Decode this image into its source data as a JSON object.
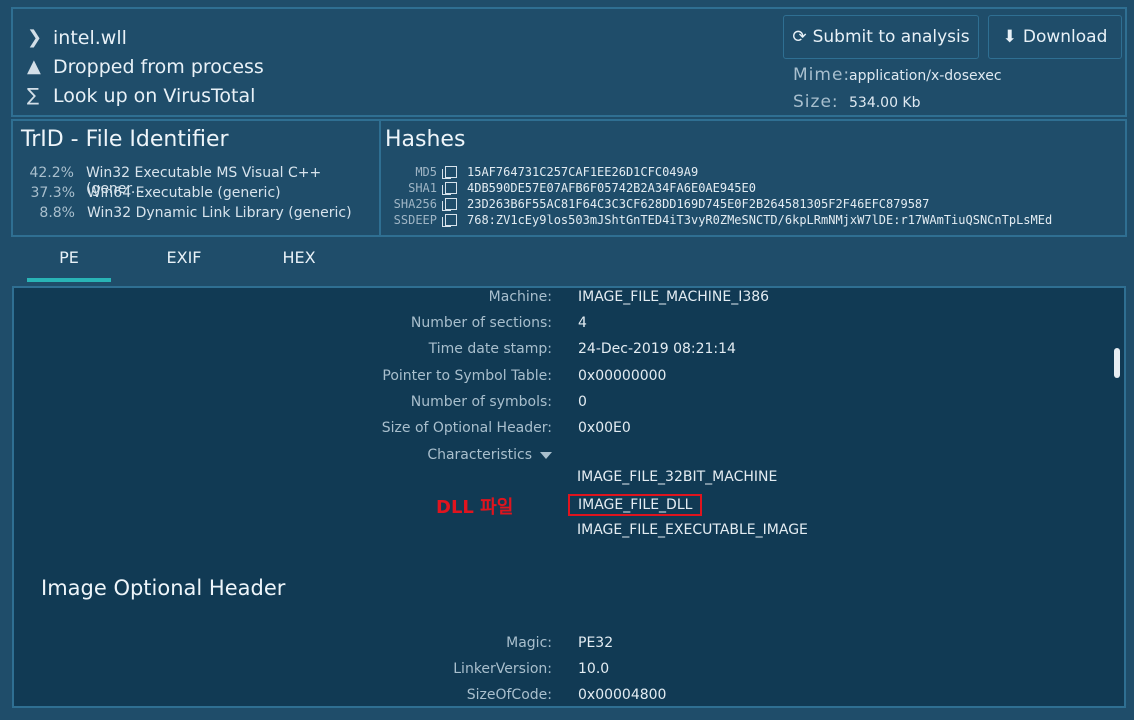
{
  "file": {
    "name": "intel.wll",
    "warning": "Dropped from process",
    "lookup": "Look up on VirusTotal",
    "icons": [
      "chevron-right-icon",
      "warning-icon",
      "sigma-icon"
    ]
  },
  "actions": {
    "submit": "Submit to analysis",
    "download": "Download"
  },
  "meta": {
    "mime_label": "Mime:",
    "mime_value": "application/x-dosexec",
    "size_label": "Size:",
    "size_value": "534.00 Kb"
  },
  "trid": {
    "title": "TrID - File Identifier",
    "items": [
      {
        "pct": "42.2%",
        "label": "Win32 Executable MS Visual C++ (gener..."
      },
      {
        "pct": "37.3%",
        "label": "Win64 Executable (generic)"
      },
      {
        "pct": "8.8%",
        "label": "Win32 Dynamic Link Library (generic)"
      }
    ]
  },
  "hashes": {
    "title": "Hashes",
    "items": [
      {
        "key": "MD5",
        "value": "15AF764731C257CAF1EE26D1CFC049A9"
      },
      {
        "key": "SHA1",
        "value": "4DB590DE57E07AFB6F05742B2A34FA6E0AE945E0"
      },
      {
        "key": "SHA256",
        "value": "23D263B6F55AC81F64C3C3CF628DD169D745E0F2B264581305F2F46EFC879587"
      },
      {
        "key": "SSDEEP",
        "value": "768:ZV1cEy9los503mJShtGnTED4iT3vyR0ZMeSNCTD/6kpLRmNMjxW7lDE:r17WAmTiuQSNCnTpLsMEd"
      }
    ]
  },
  "tabs": [
    "PE",
    "EXIF",
    "HEX"
  ],
  "pe": {
    "rows": [
      {
        "key": "Machine:",
        "value": "IMAGE_FILE_MACHINE_I386"
      },
      {
        "key": "Number of sections:",
        "value": "4"
      },
      {
        "key": "Time date stamp:",
        "value": "24-Dec-2019 08:21:14"
      },
      {
        "key": "Pointer to Symbol Table:",
        "value": "0x00000000"
      },
      {
        "key": "Number of symbols:",
        "value": "0"
      },
      {
        "key": "Size of Optional Header:",
        "value": "0x00E0"
      }
    ],
    "characteristics_label": "Characteristics",
    "flags": [
      "IMAGE_FILE_32BIT_MACHINE",
      "IMAGE_FILE_DLL",
      "IMAGE_FILE_EXECUTABLE_IMAGE"
    ],
    "annotation": "DLL 파일",
    "optional_header_title": "Image Optional Header",
    "optional_rows": [
      {
        "key": "Magic:",
        "value": "PE32"
      },
      {
        "key": "LinkerVersion:",
        "value": "10.0"
      },
      {
        "key": "SizeOfCode:",
        "value": "0x00004800"
      }
    ]
  },
  "colors": {
    "background": "#1f4d6a",
    "content_bg": "#113a54",
    "border": "#2f6f92",
    "tab_active": "#29b4b6",
    "annotation": "#e0141e"
  }
}
